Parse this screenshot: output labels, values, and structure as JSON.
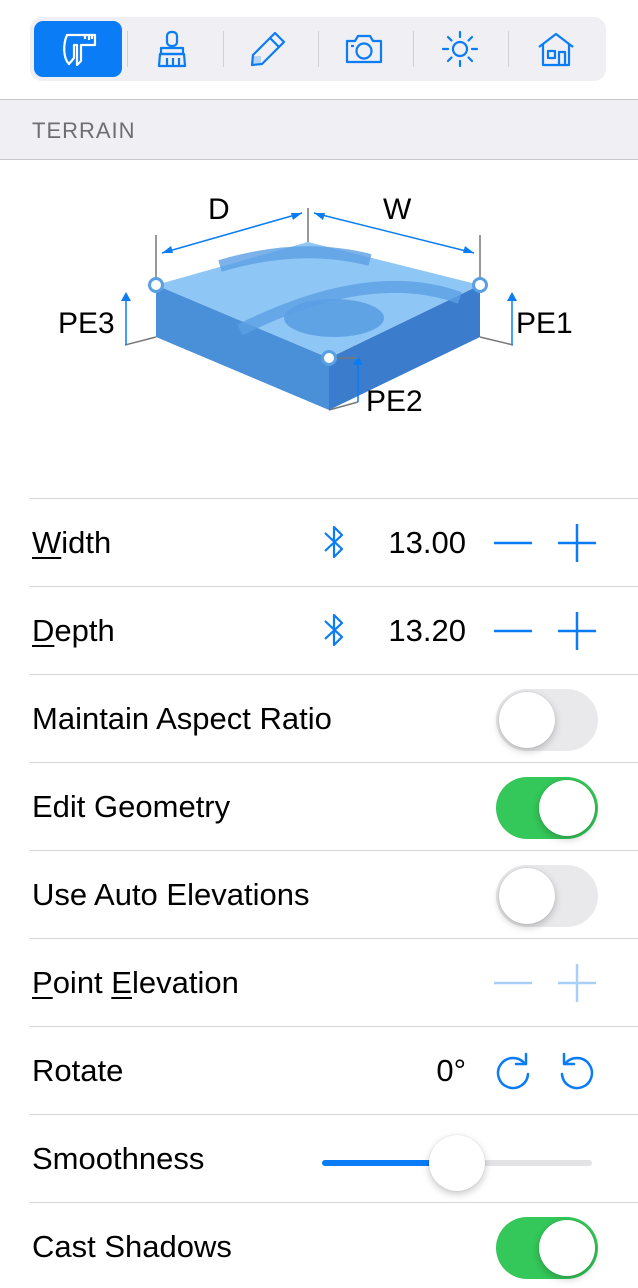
{
  "toolbar": {
    "tools": [
      {
        "icon": "caliper-icon",
        "active": true
      },
      {
        "icon": "brush-icon",
        "active": false
      },
      {
        "icon": "pencil-icon",
        "active": false
      },
      {
        "icon": "camera-icon",
        "active": false
      },
      {
        "icon": "sun-icon",
        "active": false
      },
      {
        "icon": "house-icon",
        "active": false
      }
    ]
  },
  "section": {
    "title": "TERRAIN"
  },
  "diagram": {
    "labels": {
      "d": "D",
      "w": "W",
      "pe1": "PE1",
      "pe2": "PE2",
      "pe3": "PE3"
    }
  },
  "rows": {
    "width": {
      "label_u": "W",
      "label_rest": "idth",
      "value": "13.00"
    },
    "depth": {
      "label_u": "D",
      "label_rest": "epth",
      "value": "13.20"
    },
    "aspect": {
      "label": "Maintain Aspect Ratio",
      "on": false
    },
    "geometry": {
      "label": "Edit Geometry",
      "on": true
    },
    "auto_elev": {
      "label": "Use Auto Elevations",
      "on": false
    },
    "point_elev": {
      "label_u1": "P",
      "label_mid": "oint ",
      "label_u2": "E",
      "label_rest": "levation",
      "enabled": false
    },
    "rotate": {
      "label": "Rotate",
      "value": "0°"
    },
    "smoothness": {
      "label": "Smoothness",
      "level_percent": 50
    },
    "shadows": {
      "label": "Cast Shadows",
      "on": true
    }
  },
  "colors": {
    "accent": "#0a7cf5",
    "toggle_on": "#34c759",
    "toggle_off": "#e9e9eb"
  }
}
